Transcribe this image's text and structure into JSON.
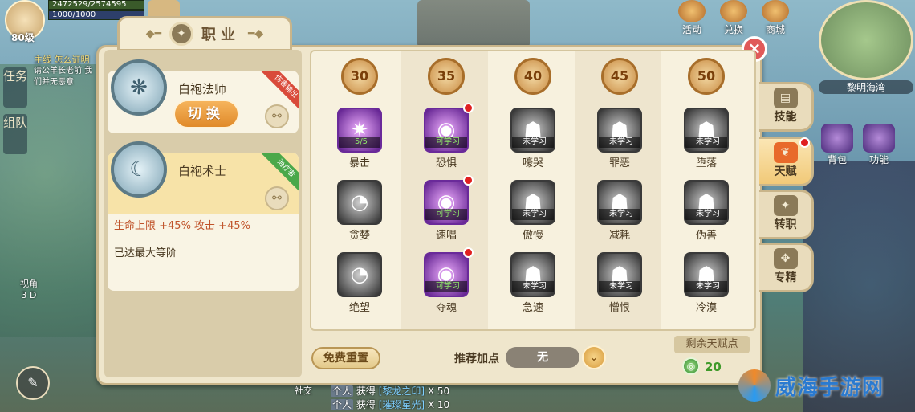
{
  "hud": {
    "level": "80级",
    "hp_text": "2472529/2574595",
    "mp_text": "1000/1000"
  },
  "left_menu": {
    "task": "任务",
    "team": "组队",
    "quest_title": "主线",
    "quest_title_extra": "怎么证明",
    "quest_desc": "请公羊长老前 我们并无恶意",
    "view_label": "视角",
    "view_value": "3 D"
  },
  "top_icons": [
    {
      "label": "活动",
      "icon": "event-icon"
    },
    {
      "label": "兑换",
      "icon": "exchange-icon"
    },
    {
      "label": "商城",
      "icon": "shop-icon"
    }
  ],
  "minimap": {
    "location": "黎明海湾"
  },
  "right_hud": [
    {
      "label": "背包",
      "icon": "bag-icon"
    },
    {
      "label": "功能",
      "icon": "function-icon"
    }
  ],
  "panel": {
    "title": "职业",
    "close": "×"
  },
  "classes": [
    {
      "name": "白袍法师",
      "button": "切换",
      "ribbon": "伤害输出"
    },
    {
      "name": "白袍术士",
      "ribbon": "治疗者",
      "bonus": "生命上限 +45% 攻击 +45%",
      "status": "已达最大等阶"
    }
  ],
  "tiers": [
    "30",
    "35",
    "40",
    "45",
    "50"
  ],
  "skills": [
    [
      {
        "name": "暴击",
        "status": "5/5",
        "kind": "count",
        "dot": false,
        "icon": "critical-icon"
      },
      {
        "name": "贪婪",
        "status": "",
        "kind": "none",
        "dot": false,
        "icon": "greed-icon"
      },
      {
        "name": "绝望",
        "status": "",
        "kind": "none",
        "dot": false,
        "icon": "despair-icon"
      }
    ],
    [
      {
        "name": "恐惧",
        "status": "可学习",
        "kind": "learnable",
        "dot": true,
        "icon": "fear-icon"
      },
      {
        "name": "速唱",
        "status": "可学习",
        "kind": "learnable",
        "dot": true,
        "icon": "quick-chant-icon"
      },
      {
        "name": "夺魂",
        "status": "可学习",
        "kind": "learnable",
        "dot": true,
        "icon": "soul-steal-icon"
      }
    ],
    [
      {
        "name": "嚎哭",
        "status": "未学习",
        "kind": "locked",
        "dot": false,
        "icon": "wail-icon"
      },
      {
        "name": "傲慢",
        "status": "未学习",
        "kind": "locked",
        "dot": false,
        "icon": "pride-icon"
      },
      {
        "name": "急速",
        "status": "未学习",
        "kind": "locked",
        "dot": false,
        "icon": "haste-icon"
      }
    ],
    [
      {
        "name": "罪恶",
        "status": "未学习",
        "kind": "locked",
        "dot": false,
        "icon": "sin-icon"
      },
      {
        "name": "减耗",
        "status": "未学习",
        "kind": "locked",
        "dot": false,
        "icon": "cost-reduce-icon"
      },
      {
        "name": "憎恨",
        "status": "未学习",
        "kind": "locked",
        "dot": false,
        "icon": "hatred-icon"
      }
    ],
    [
      {
        "name": "堕落",
        "status": "未学习",
        "kind": "locked",
        "dot": false,
        "icon": "fall-icon"
      },
      {
        "name": "伪善",
        "status": "未学习",
        "kind": "locked",
        "dot": false,
        "icon": "hypocrisy-icon"
      },
      {
        "name": "冷漠",
        "status": "未学习",
        "kind": "locked",
        "dot": false,
        "icon": "indifference-icon"
      }
    ]
  ],
  "controls": {
    "reset": "免费重置",
    "recommend_label": "推荐加点",
    "recommend_value": "无",
    "points_label": "剩余天赋点",
    "points_value": "20"
  },
  "side_tabs": [
    {
      "label": "技能",
      "icon": "book-icon",
      "active": false,
      "dot": false
    },
    {
      "label": "天赋",
      "icon": "wing-icon",
      "active": true,
      "dot": true
    },
    {
      "label": "转职",
      "icon": "class-change-icon",
      "active": false,
      "dot": false
    },
    {
      "label": "专精",
      "icon": "specialty-icon",
      "active": false,
      "dot": false
    }
  ],
  "chat": [
    {
      "tag": "个人",
      "text": "获得",
      "item": "[黎龙之印]",
      "count": "X 50"
    },
    {
      "tag": "个人",
      "text": "获得",
      "item": "[璀璨星光]",
      "count": "X 10"
    }
  ],
  "social": "社交",
  "watermark": "威海手游网"
}
